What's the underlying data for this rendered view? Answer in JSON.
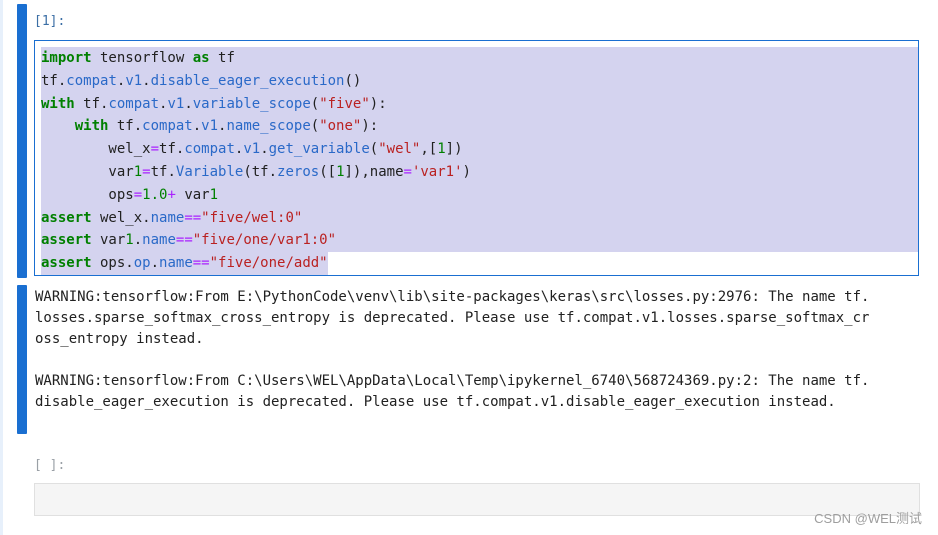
{
  "cells": [
    {
      "prompt": "[1]:",
      "code": [
        "import tensorflow as tf",
        "tf.compat.v1.disable_eager_execution()",
        "with tf.compat.v1.variable_scope(\"five\"):",
        "    with tf.compat.v1.name_scope(\"one\"):",
        "        wel_x=tf.compat.v1.get_variable(\"wel\",[1])",
        "        var1=tf.Variable(tf.zeros([1]),name='var1')",
        "        ops=1.0+ var1",
        "assert wel_x.name==\"five/wel:0\"",
        "assert var1.name==\"five/one/var1:0\"",
        "assert ops.op.name==\"five/one/add\""
      ],
      "output": [
        "WARNING:tensorflow:From E:\\PythonCode\\venv\\lib\\site-packages\\keras\\src\\losses.py:2976: The name tf.",
        "losses.sparse_softmax_cross_entropy is deprecated. Please use tf.compat.v1.losses.sparse_softmax_cr",
        "oss_entropy instead.",
        "",
        "WARNING:tensorflow:From C:\\Users\\WEL\\AppData\\Local\\Temp\\ipykernel_6740\\568724369.py:2: The name tf.",
        "disable_eager_execution is deprecated. Please use tf.compat.v1.disable_eager_execution instead."
      ]
    },
    {
      "prompt": "[ ]:",
      "code": []
    }
  ],
  "watermark": "CSDN @WEL测试",
  "colors": {
    "cell_bar": "#1a6fd1",
    "selection": "#d4d3ef",
    "keyword": "#008000",
    "string": "#ba2121",
    "attribute": "#2a69c8"
  }
}
